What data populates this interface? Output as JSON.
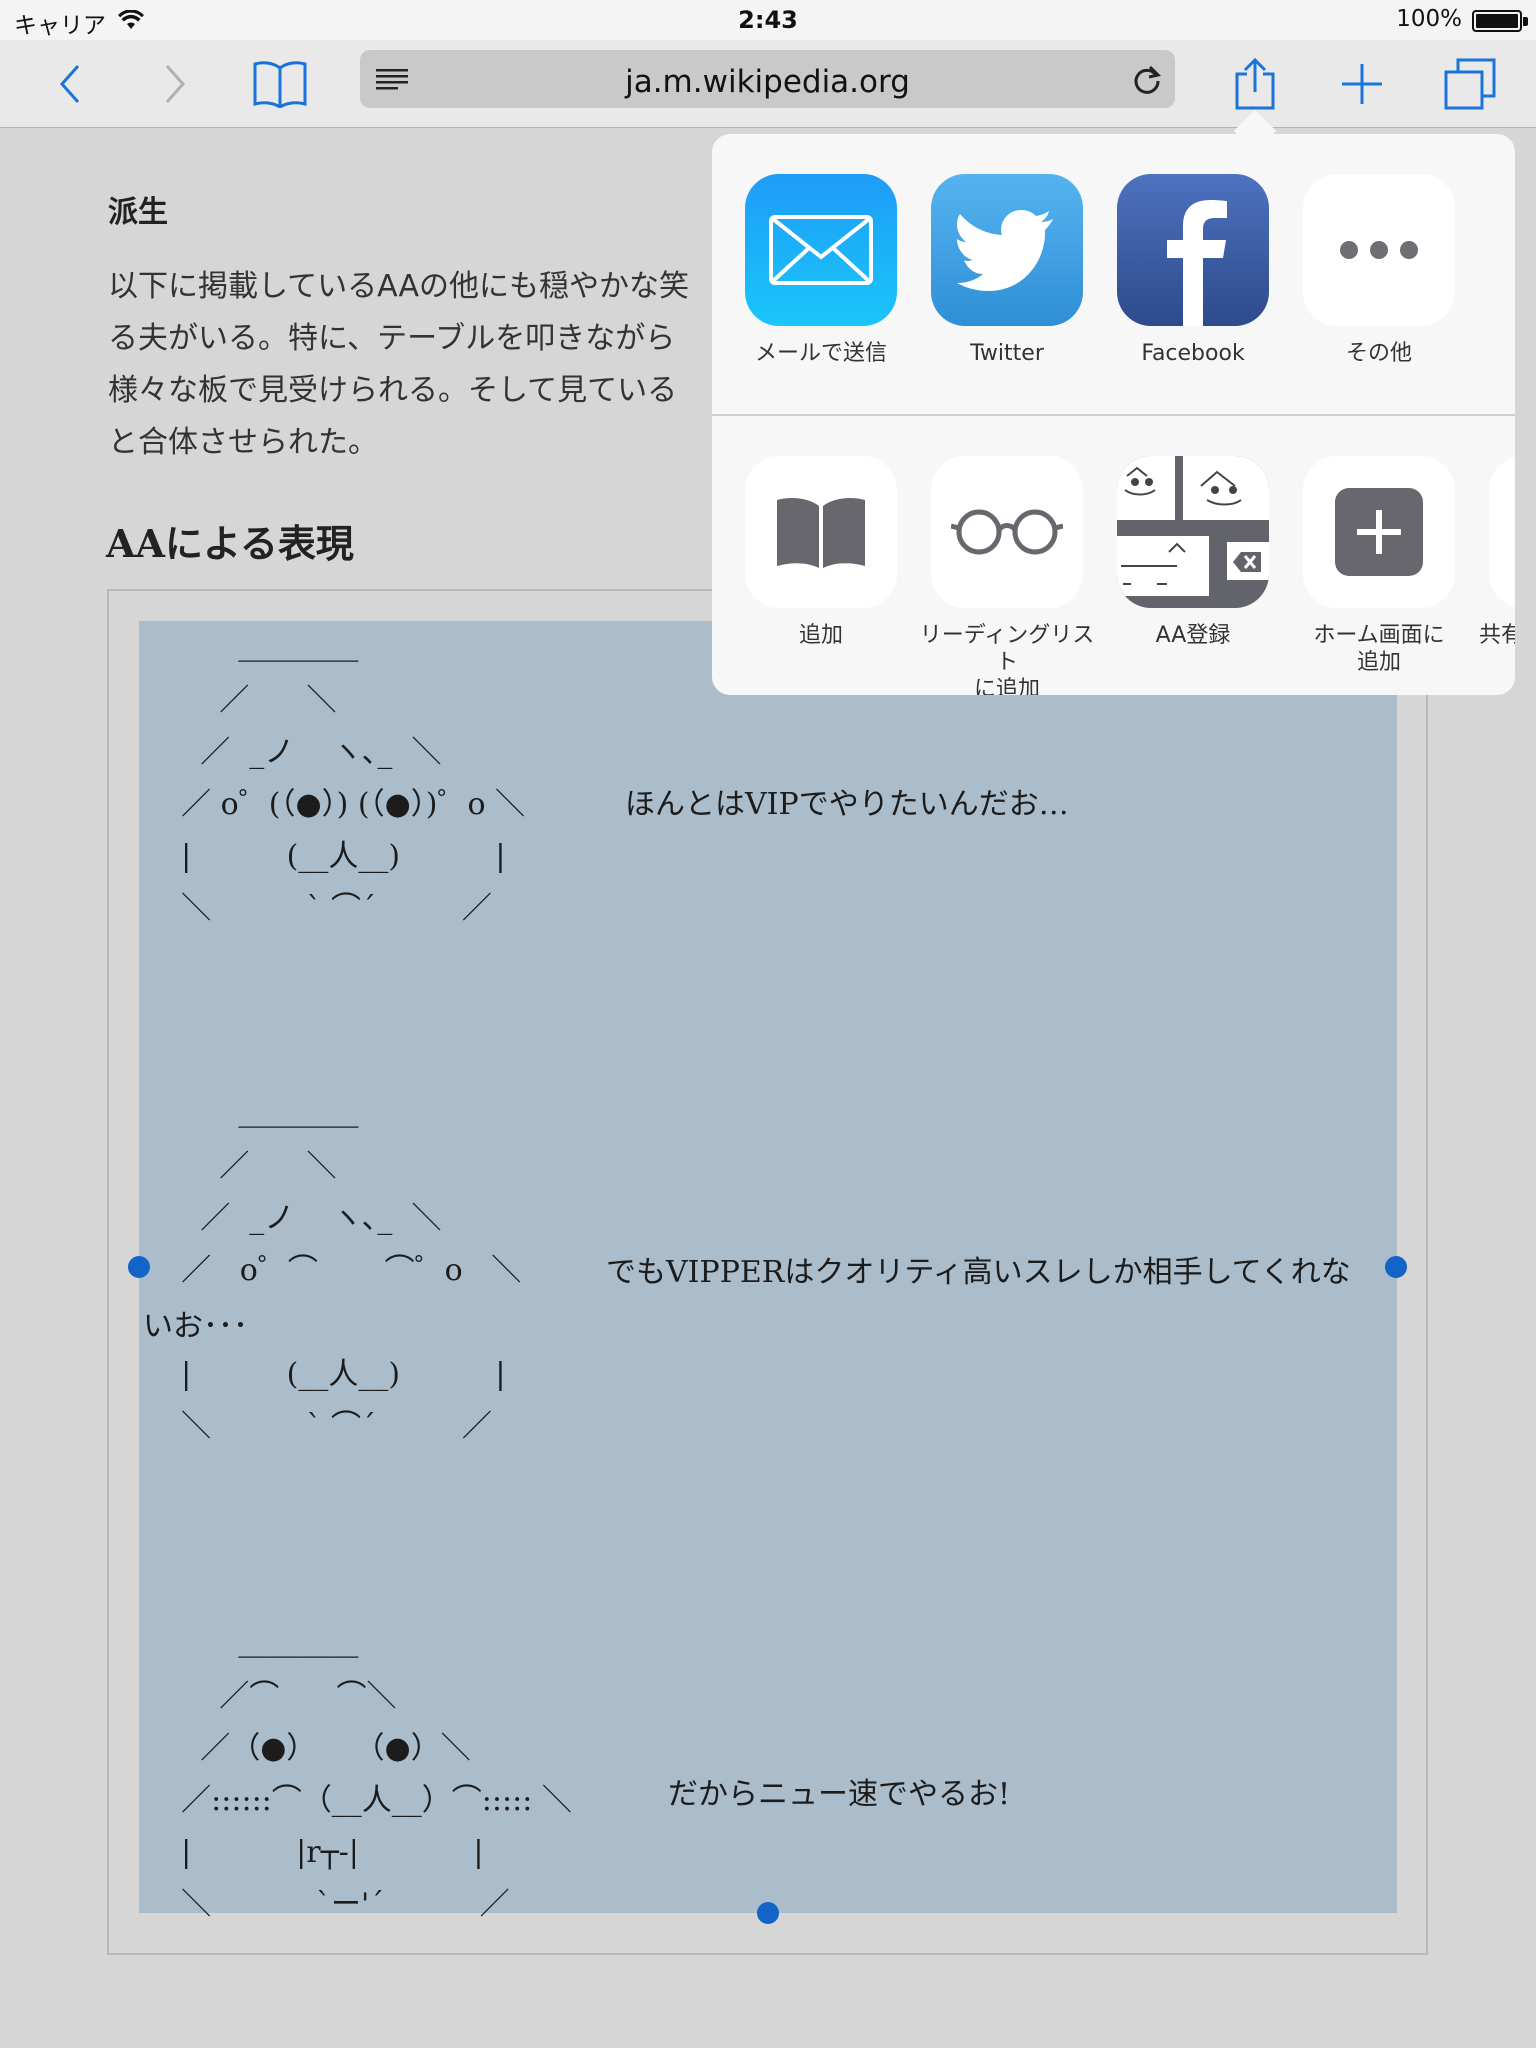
{
  "status_bar": {
    "carrier": "キャリア",
    "time": "2:43",
    "battery": "100%"
  },
  "toolbar": {
    "url": "ja.m.wikipedia.org"
  },
  "article": {
    "section_heading": "派生",
    "paragraph_lines": [
      "以下に掲載しているAAの他にも穏やかな笑",
      "る夫がいる。特に、テーブルを叩きながら",
      "様々な板で見受けられる。そして見ている",
      "と合体させられた。"
    ],
    "aa_heading": "AAによる表現",
    "aa_blocks": [
      {
        "art": "          ＿＿＿＿\n        ／      ＼\n      ／  _ノ    ヽ､_  ＼\n    ／ o゜(（●）) (（●）)゜o ＼\n    |          (__人__)          |\n    ＼          ` ⌒´         ／",
        "caption": "ほんとはVIPでやりたいんだお…"
      },
      {
        "art": "          ＿＿＿＿\n        ／      ＼\n      ／  _ノ    ヽ､_  ＼\n    ／   o゜⌒       ⌒゜o   ＼",
        "caption": "でもVIPPERはクオリティ高いスレしか相手してくれな",
        "caption_cont": "いお･･･",
        "art_after": "    |          (__人__)          |\n    ＼          ` ⌒´         ／"
      },
      {
        "art": "          ＿＿＿＿\n        ／⌒      ⌒＼\n      ／（●）    （●）＼\n    ／::::::⌒（__人__）⌒::::: ＼\n    |           |r┬-|            |\n    ＼           `ー'´          ／",
        "caption": "だからニュー速でやるお!"
      }
    ]
  },
  "share_sheet": {
    "row1": [
      {
        "label": "メールで送信",
        "icon": "mail-icon",
        "color": "#1f8ff5"
      },
      {
        "label": "Twitter",
        "icon": "twitter-icon",
        "color": "#3c9ee2"
      },
      {
        "label": "Facebook",
        "icon": "facebook-icon",
        "color": "#3b5ca8"
      },
      {
        "label": "その他",
        "icon": "more-icon",
        "color": "#ffffff"
      }
    ],
    "row2": [
      {
        "label": "追加",
        "icon": "book-icon"
      },
      {
        "label": "リーディングリスト\nに追加",
        "icon": "glasses-icon"
      },
      {
        "label": "AA登録",
        "icon": "aa-keyboard-icon"
      },
      {
        "label": "ホーム画面に\n追加",
        "icon": "plus-icon"
      },
      {
        "label": "共有",
        "icon": "share-extension-icon"
      }
    ]
  },
  "colors": {
    "accent": "#1a73d9",
    "selection": "#abbcca",
    "selection_handle": "#1264c8"
  }
}
